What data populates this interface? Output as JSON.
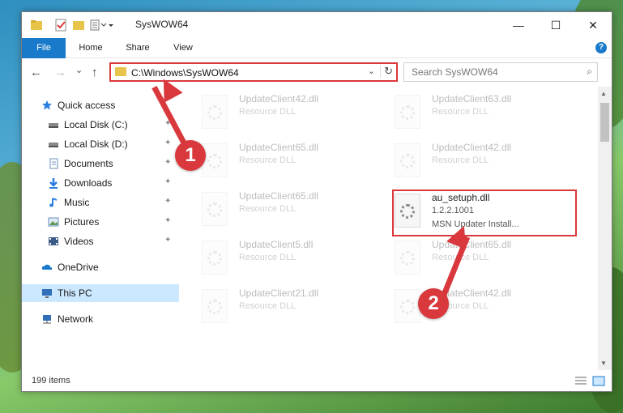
{
  "window": {
    "title": "SysWOW64",
    "controls": {
      "minimize": "—",
      "maximize": "☐",
      "close": "✕"
    }
  },
  "ribbon": {
    "tabs": [
      "File",
      "Home",
      "Share",
      "View"
    ],
    "help": "?"
  },
  "nav": {
    "back": "←",
    "forward": "→",
    "recent": "⌄",
    "up": "↑",
    "address": "C:\\Windows\\SysWOW64",
    "dropdown": "⌄",
    "refresh": "↻",
    "search_placeholder": "Search SysWOW64",
    "search_icon": "⌕"
  },
  "sidebar": {
    "items": [
      {
        "label": "Quick access",
        "icon": "star-icon",
        "pinned": false
      },
      {
        "label": "Local Disk (C:)",
        "icon": "drive-icon",
        "pinned": true
      },
      {
        "label": "Local Disk (D:)",
        "icon": "drive-icon",
        "pinned": true
      },
      {
        "label": "Documents",
        "icon": "documents-icon",
        "pinned": true
      },
      {
        "label": "Downloads",
        "icon": "download-icon",
        "pinned": true
      },
      {
        "label": "Music",
        "icon": "music-icon",
        "pinned": true
      },
      {
        "label": "Pictures",
        "icon": "pictures-icon",
        "pinned": true
      },
      {
        "label": "Videos",
        "icon": "videos-icon",
        "pinned": true
      },
      {
        "label": "OneDrive",
        "icon": "cloud-icon",
        "pinned": false
      },
      {
        "label": "This PC",
        "icon": "computer-icon",
        "pinned": false,
        "selected": true
      },
      {
        "label": "Network",
        "icon": "network-icon",
        "pinned": false
      }
    ],
    "pin_glyph": "📌"
  },
  "files": [
    {
      "name": "UpdateClient42.dll",
      "desc": "Resource DLL"
    },
    {
      "name": "UpdateClient63.dll",
      "desc": "Resource DLL"
    },
    {
      "name": "UpdateClient65.dll",
      "desc": "Resource DLL"
    },
    {
      "name": "UpdateClient42.dll",
      "desc": "Resource DLL"
    },
    {
      "name": "UpdateClient65.dll",
      "desc": "Resource DLL"
    },
    {
      "name": "au_setuph.dll",
      "version": "1.2.2.1001",
      "desc": "MSN Updater Install..."
    },
    {
      "name": "UpdateClient5.dll",
      "desc": "Resource DLL"
    },
    {
      "name": "UpdateClient65.dll",
      "desc": "Resource DLL"
    },
    {
      "name": "UpdateClient21.dll",
      "desc": "Resource DLL"
    },
    {
      "name": "UpdateClient42.dll",
      "desc": "Resource DLL"
    }
  ],
  "status": {
    "item_count": "199 items"
  },
  "annotations": {
    "badge1": "1",
    "badge2": "2"
  },
  "colors": {
    "accent": "#1979ca",
    "highlight": "#d9383c",
    "selected": "#cce8ff"
  }
}
